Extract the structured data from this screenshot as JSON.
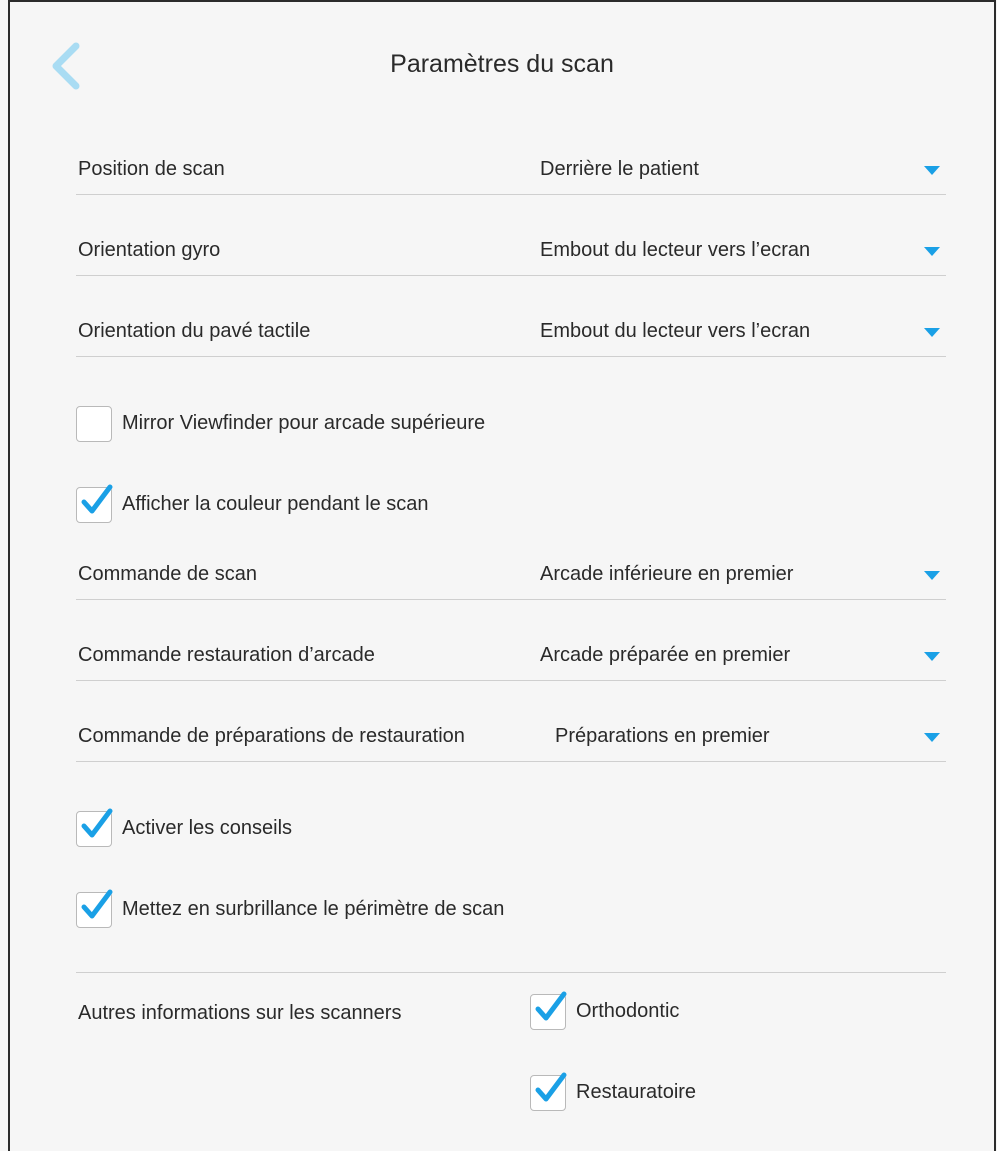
{
  "header": {
    "title": "Paramètres du scan",
    "back_icon": "chevron-left-icon",
    "accent_color": "#1aa0e6"
  },
  "dropdowns": [
    {
      "label": "Position de scan",
      "value": "Derrière le patient"
    },
    {
      "label": "Orientation gyro",
      "value": "Embout du lecteur vers l’ecran"
    },
    {
      "label": "Orientation du pavé tactile",
      "value": "Embout du lecteur vers l’ecran"
    },
    {
      "label": "Commande de scan",
      "value": "Arcade inférieure en premier"
    },
    {
      "label": "Commande restauration d’arcade",
      "value": "Arcade préparée en premier"
    },
    {
      "label": "Commande de préparations de restauration",
      "value": "Préparations en premier"
    }
  ],
  "checkboxes": [
    {
      "label": "Mirror Viewfinder pour arcade supérieure",
      "checked": false
    },
    {
      "label": "Afficher la couleur pendant le scan",
      "checked": true
    },
    {
      "label": "Activer les conseils",
      "checked": true
    },
    {
      "label": "Mettez en surbrillance le périmètre de scan",
      "checked": true
    }
  ],
  "other_scanners": {
    "label": "Autres informations sur les scanners",
    "options": [
      {
        "label": "Orthodontic",
        "checked": true
      },
      {
        "label": "Restauratoire",
        "checked": true
      }
    ]
  }
}
